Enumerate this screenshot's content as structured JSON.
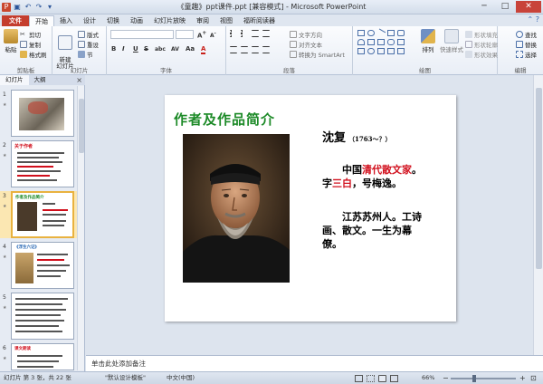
{
  "window": {
    "title": "《童趣》ppt课件.ppt [兼容模式] - Microsoft PowerPoint",
    "minimize": "─",
    "maximize": "□",
    "close": "✕"
  },
  "tabs": [
    {
      "label": "文件"
    },
    {
      "label": "开始"
    },
    {
      "label": "插入"
    },
    {
      "label": "设计"
    },
    {
      "label": "切换"
    },
    {
      "label": "动画"
    },
    {
      "label": "幻灯片放映"
    },
    {
      "label": "审阅"
    },
    {
      "label": "视图"
    },
    {
      "label": "福昕阅读器"
    }
  ],
  "ribbon": {
    "clipboard": {
      "paste": "粘贴",
      "cut": "剪切",
      "copy": "复制",
      "format_painter": "格式刷",
      "group": "剪贴板"
    },
    "slides": {
      "new_slide": "新建\n幻灯片",
      "layout": "版式",
      "reset": "重设",
      "section": "节",
      "group": "幻灯片"
    },
    "font": {
      "group": "字体",
      "bold": "B",
      "italic": "I",
      "underline": "U",
      "strike": "S",
      "shadow": "abc",
      "spacing": "AV",
      "case": "Aa",
      "color": "A"
    },
    "paragraph": {
      "group": "段落",
      "text_direction": "文字方向",
      "align_text": "对齐文本",
      "smartart": "转换为 SmartArt"
    },
    "drawing": {
      "group": "绘图",
      "arrange": "排列",
      "quick_styles": "快速样式",
      "shape_fill": "形状填充",
      "shape_outline": "形状轮廓",
      "shape_effects": "形状效果"
    },
    "editing": {
      "group": "编辑",
      "find": "查找",
      "replace": "替换",
      "select": "选择"
    }
  },
  "left_pane": {
    "tabs": [
      "幻灯片",
      "大纲"
    ],
    "close": "×",
    "thumbnails": [
      {
        "num": "1",
        "star": "★",
        "heading": ""
      },
      {
        "num": "2",
        "star": "★",
        "heading": "关于作者"
      },
      {
        "num": "3",
        "star": "★",
        "heading": "作者及作品简介"
      },
      {
        "num": "4",
        "star": "★",
        "heading": "《浮生六记》"
      },
      {
        "num": "5",
        "star": "★",
        "heading": ""
      },
      {
        "num": "6",
        "star": "★",
        "heading": "课文朗读"
      }
    ]
  },
  "slide": {
    "title": "作者及作品简介",
    "name": "沈复",
    "years": "（1763～？）",
    "para1": [
      {
        "text": "　　中国",
        "red": false
      },
      {
        "text": "清代散文家",
        "red": true
      },
      {
        "text": "。字",
        "red": false
      },
      {
        "text": "三白",
        "red": true
      },
      {
        "text": "，号梅逸。",
        "red": false
      }
    ],
    "para2": "　　江苏苏州人。工诗画、散文。一生为幕僚。"
  },
  "notes": {
    "placeholder": "单击此处添加备注"
  },
  "status": {
    "slide_info": "幻灯片 第 3 张，共 22 张",
    "theme": "\"默认设计模板\"",
    "language": "中文(中国)",
    "zoom": "66%",
    "zoom_level": 66
  },
  "colors": {
    "accent": "#c43d2e",
    "title_green": "#1c8a27",
    "highlight_red": "#d10f1c"
  }
}
